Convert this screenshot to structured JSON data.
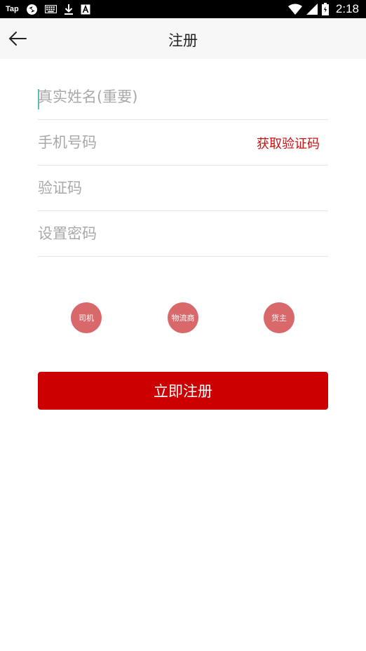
{
  "status_bar": {
    "app_label": "Tap",
    "time": "2:18",
    "icons": [
      "app-sync-icon",
      "keyboard-icon",
      "download-icon",
      "font-a-icon",
      "wifi-icon",
      "cell-signal-icon",
      "battery-icon"
    ]
  },
  "header": {
    "title": "注册",
    "back_icon": "arrow-left-icon"
  },
  "form": {
    "name_placeholder": "真实姓名(重要)",
    "phone_placeholder": "手机号码",
    "get_code_label": "获取验证码",
    "code_placeholder": "验证码",
    "password_placeholder": "设置密码"
  },
  "roles": [
    {
      "label": "司机"
    },
    {
      "label": "物流商"
    },
    {
      "label": "货主"
    }
  ],
  "submit_label": "立即注册",
  "colors": {
    "accent": "#cc0000",
    "role_circle": "#d9686a",
    "link": "#cc1111",
    "header_bg": "#f7f7f7"
  }
}
